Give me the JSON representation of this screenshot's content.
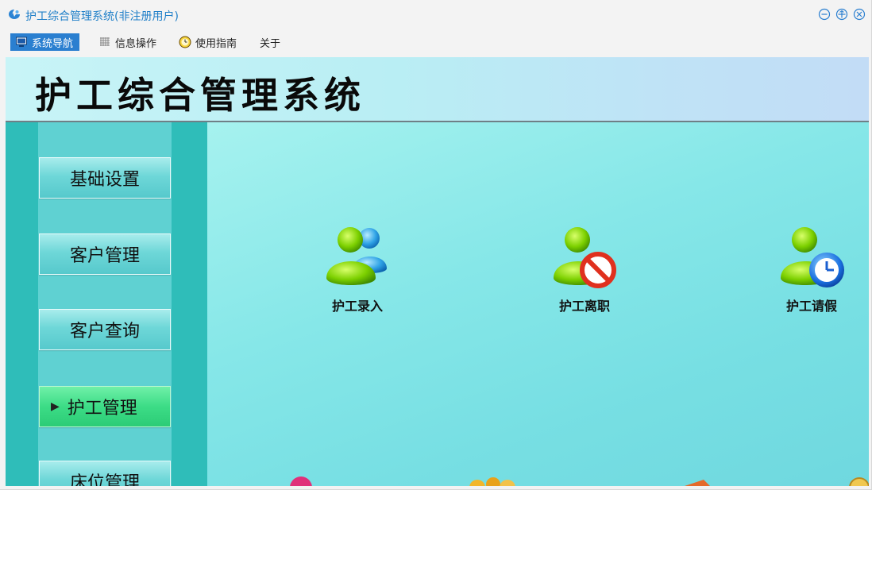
{
  "window": {
    "title": "护工综合管理系统(非注册用户)"
  },
  "menubar": {
    "items": [
      {
        "label": "系统导航",
        "icon": "monitor-icon"
      },
      {
        "label": "信息操作",
        "icon": "grid-icon"
      },
      {
        "label": "使用指南",
        "icon": "clock-icon"
      },
      {
        "label": "关于",
        "icon": ""
      }
    ]
  },
  "banner": {
    "title": "护工综合管理系统"
  },
  "sidebar": {
    "items": [
      {
        "label": "基础设置"
      },
      {
        "label": "客户管理"
      },
      {
        "label": "客户查询"
      },
      {
        "label": "护工管理",
        "active": true
      },
      {
        "label": "床位管理"
      }
    ]
  },
  "tiles": [
    {
      "label": "护工录入",
      "icon": "users-icon"
    },
    {
      "label": "护工离职",
      "icon": "user-forbidden-icon"
    },
    {
      "label": "护工请假",
      "icon": "user-clock-icon"
    }
  ],
  "colors": {
    "accent": "#2a7fd0",
    "sidebar": "#2fbdb9",
    "active_item": "#3cdc86",
    "content": "#86e7e8"
  }
}
